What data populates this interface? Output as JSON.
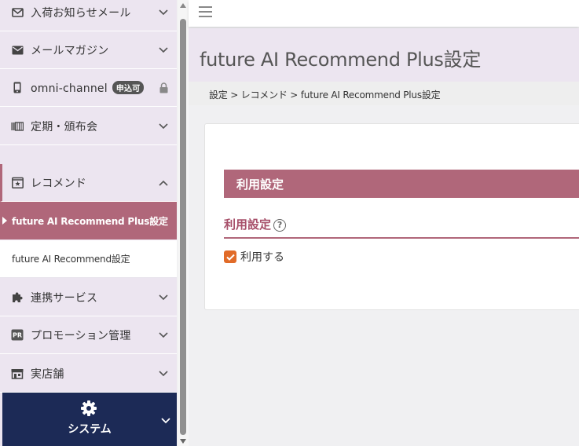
{
  "sidebar": {
    "items": [
      {
        "label": "入荷お知らせメール",
        "icon": "envelope-outline-icon"
      },
      {
        "label": "メールマガジン",
        "icon": "envelope-icon"
      },
      {
        "label": "omni-channel",
        "badge": "申込可",
        "icon": "mobile-icon",
        "trailing_icon": "lock-icon"
      },
      {
        "label": "定期・頒布会",
        "icon": "subscription-icon"
      },
      {
        "label": "レコメンド",
        "icon": "star-box-icon",
        "expanded": true
      },
      {
        "label": "連携サービス",
        "icon": "puzzle-icon"
      },
      {
        "label": "プロモーション管理",
        "icon": "pr-icon"
      },
      {
        "label": "実店舗",
        "icon": "store-icon"
      }
    ],
    "sub_items": [
      {
        "label": "future AI Recommend Plus設定",
        "active": true
      },
      {
        "label": "future AI Recommend設定",
        "active": false
      }
    ],
    "system": {
      "label": "システム",
      "icon": "gear-icon"
    }
  },
  "header": {
    "menu_icon": "hamburger-icon"
  },
  "page": {
    "title": "future AI Recommend Plus設定",
    "breadcrumb": "設定 > レコメンド > future AI Recommend Plus設定"
  },
  "form": {
    "section_title": "利用設定",
    "field_label": "利用設定",
    "help_glyph": "?",
    "checkbox_label": "利用する",
    "checkbox_checked": true
  },
  "colors": {
    "accent": "#b0677a",
    "sidebar_bg": "#ece5f0",
    "system_bg": "#1c2a56",
    "checkbox": "#e16b28"
  }
}
